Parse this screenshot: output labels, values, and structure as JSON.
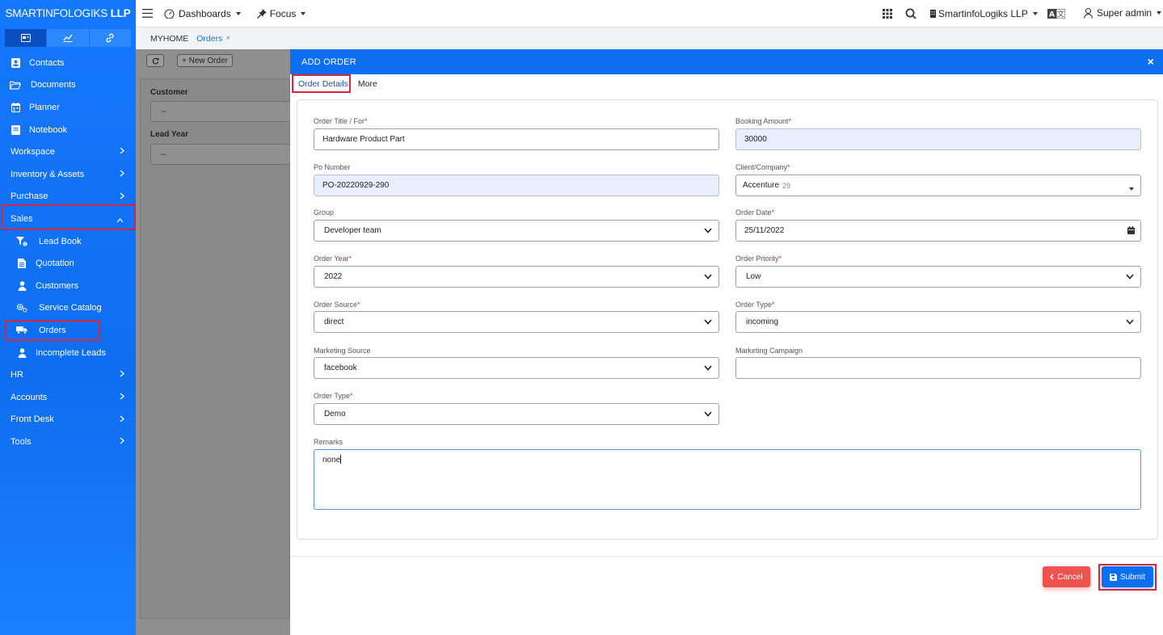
{
  "brand": {
    "prefix": "SMARTINFOLOGIKS ",
    "suffix": "LLP"
  },
  "sidebar": {
    "items": [
      {
        "label": "Contacts",
        "icon": "contact-icon"
      },
      {
        "label": "Documents",
        "icon": "folder-icon"
      },
      {
        "label": "Planner",
        "icon": "calendar-icon"
      },
      {
        "label": "Notebook",
        "icon": "notebook-icon"
      },
      {
        "label": "Workspace"
      },
      {
        "label": "Inventory & Assets"
      },
      {
        "label": "Purchase"
      },
      {
        "label": "Sales"
      },
      {
        "label": "Lead Book",
        "icon": "funnel-icon"
      },
      {
        "label": "Quotation",
        "icon": "document-icon"
      },
      {
        "label": "Customers",
        "icon": "user-icon"
      },
      {
        "label": "Service Catalog",
        "icon": "gears-icon"
      },
      {
        "label": "Orders",
        "icon": "truck-icon"
      },
      {
        "label": "Incomplete Leads",
        "icon": "user-icon"
      },
      {
        "label": "HR"
      },
      {
        "label": "Accounts"
      },
      {
        "label": "Front Desk"
      },
      {
        "label": "Tools"
      }
    ]
  },
  "topbar": {
    "dashboards": "Dashboards",
    "focus": "Focus",
    "company": "SmartinfoLogiks LLP",
    "user": "Super admin"
  },
  "breadcrumb": {
    "home": "MYHOME",
    "tab": "Orders",
    "close": "×"
  },
  "background_page": {
    "new_order": "+ New Order",
    "customer_label": "Customer",
    "customer_value": "--",
    "lead_year_label": "Lead Year",
    "lead_year_value": "--"
  },
  "modal": {
    "title": "ADD ORDER",
    "close": "×",
    "tabs": [
      "Order Details",
      "More"
    ],
    "fields": {
      "order_title": {
        "label": "Order Title / For",
        "value": "Hardware Product Part"
      },
      "booking_amount": {
        "label": "Booking Amount",
        "value": "30000"
      },
      "po_number": {
        "label": "Po Number",
        "value": "PO-20220929-290"
      },
      "client": {
        "label": "Client/Company",
        "value": "Accenture",
        "suffix": "29"
      },
      "group": {
        "label": "Group",
        "value": "Developer team"
      },
      "order_date": {
        "label": "Order Date",
        "value": "25/11/2022"
      },
      "order_year": {
        "label": "Order Year",
        "value": "2022"
      },
      "order_priority": {
        "label": "Order Priority",
        "value": "Low"
      },
      "order_source": {
        "label": "Order Source",
        "value": "direct"
      },
      "order_type_1": {
        "label": "Order Type",
        "value": "incoming"
      },
      "marketing_source": {
        "label": "Marketing Source",
        "value": "facebook"
      },
      "marketing_campaign": {
        "label": "Marketing Campaign",
        "value": ""
      },
      "order_type_2": {
        "label": "Order Type",
        "value": "Demo"
      },
      "remarks": {
        "label": "Remarks",
        "value": "none"
      }
    },
    "buttons": {
      "cancel": "Cancel",
      "submit": "Submit"
    }
  },
  "colors": {
    "primary": "#0d6ef0",
    "danger": "#ef5350",
    "highlight": "#d9263f",
    "required": "#e0303a"
  }
}
